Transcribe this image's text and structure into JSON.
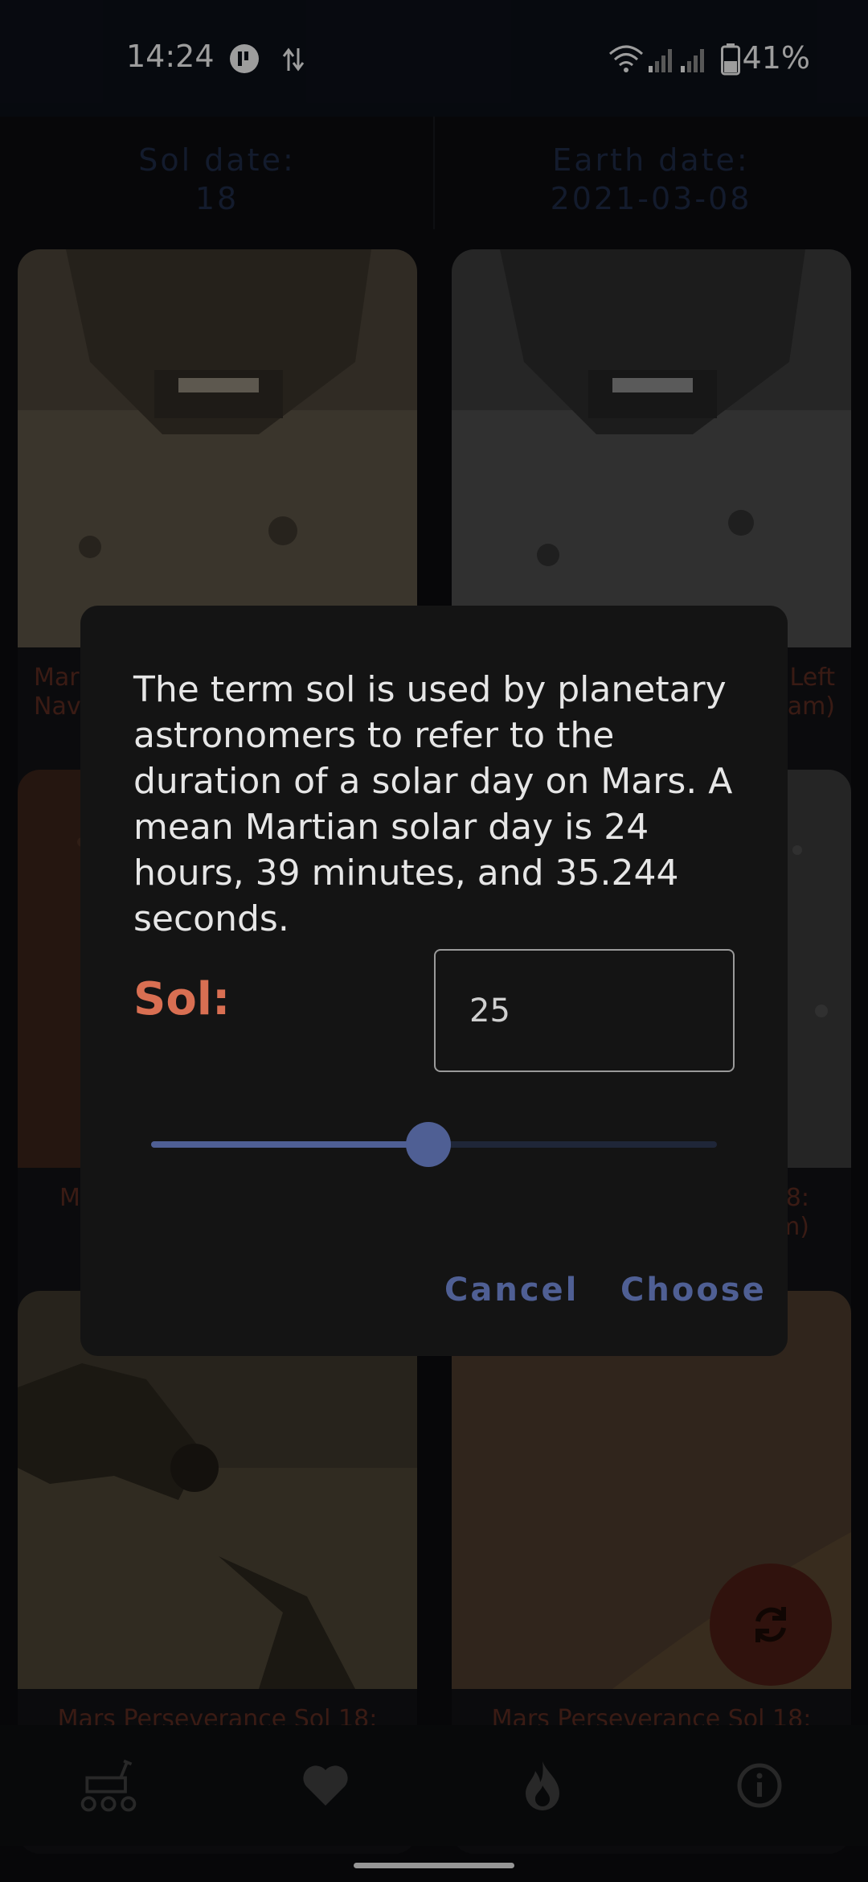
{
  "status_bar": {
    "time": "14:24",
    "battery_text": "41%"
  },
  "header": {
    "sol_label": "Sol date:",
    "sol_value": "18",
    "earth_label": "Earth date:",
    "earth_value": "2021-03-08"
  },
  "cards": [
    {
      "caption": "Mars Perseverance Sol 18: Navcam",
      "visible_caption": "Mar\nNav"
    },
    {
      "caption": "Mars Perseverance Sol 18: Left Navcam",
      "visible_caption": "Left\nam)"
    },
    {
      "caption": "Mars Perseverance Sol 18:",
      "visible_caption": "M"
    },
    {
      "caption": "Mars Perseverance Sol 18:",
      "visible_caption": "8:\nam)"
    },
    {
      "caption": "Mars Perseverance Sol 18:"
    },
    {
      "caption": "Mars Perseverance Sol 18:"
    }
  ],
  "dialog": {
    "description": "The term sol is used by planetary astronomers to refer to the duration of a solar day on Mars. A mean Martian solar day is 24 hours, 39 minutes, and 35.244 seconds.",
    "sol_label": "Sol:",
    "sol_value": "25",
    "slider_fraction": 0.49,
    "cancel_label": "Cancel",
    "choose_label": "Choose"
  },
  "nav": {
    "items": [
      "rover-icon",
      "heart-icon",
      "fire-icon",
      "info-icon"
    ]
  },
  "colors": {
    "accent": "#4f5f94",
    "sol_label": "#d96f52",
    "dialog_bg": "#141414"
  }
}
